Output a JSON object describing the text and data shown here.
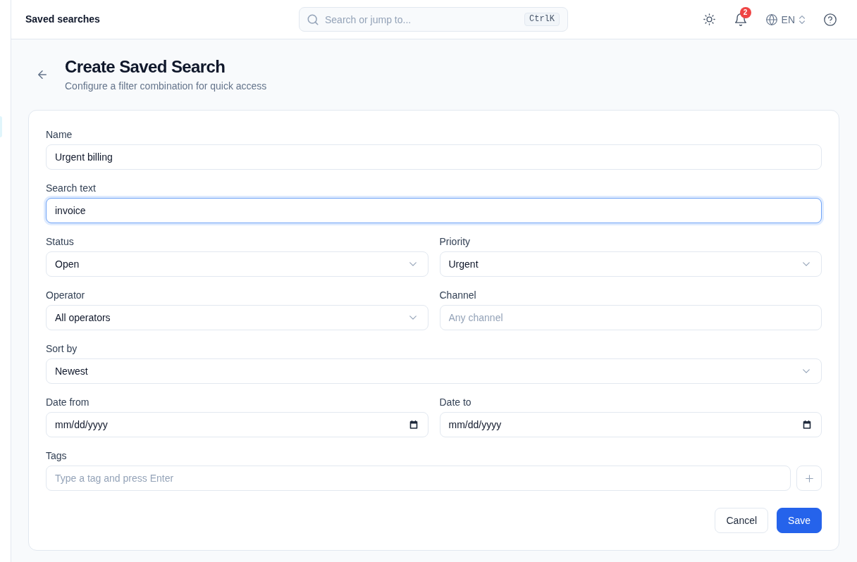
{
  "topbar": {
    "title": "Saved searches",
    "search": {
      "placeholder": "Search or jump to...",
      "shortcut": "CtrlK"
    },
    "notification_count": "2",
    "language": "EN"
  },
  "header": {
    "title": "Create Saved Search",
    "subtitle": "Configure a filter combination for quick access"
  },
  "form": {
    "rows": [
      [
        {
          "kind": "text",
          "label": "Name",
          "value": "Urgent billing",
          "focused": false
        }
      ],
      [
        {
          "kind": "text",
          "label": "Search text",
          "value": "invoice",
          "focused": true
        }
      ],
      [
        {
          "kind": "select",
          "label": "Status",
          "value": "Open",
          "focused": false
        },
        {
          "kind": "select",
          "label": "Priority",
          "value": "Urgent",
          "focused": false
        }
      ],
      [
        {
          "kind": "select",
          "label": "Operator",
          "value": "All operators",
          "focused": false
        },
        {
          "kind": "text",
          "label": "Channel",
          "placeholder": "Any channel",
          "focused": false
        }
      ],
      [
        {
          "kind": "select",
          "label": "Sort by",
          "value": "Newest",
          "focused": false
        }
      ],
      [
        {
          "kind": "date",
          "label": "Date from",
          "placeholder": "mm/dd/yyyy",
          "focused": false
        },
        {
          "kind": "date",
          "label": "Date to",
          "placeholder": "mm/dd/yyyy",
          "focused": false
        }
      ],
      [
        {
          "kind": "tags",
          "label": "Tags",
          "placeholder": "Type a tag and press Enter",
          "focused": false
        }
      ]
    ],
    "buttons": [
      {
        "kind": "secondary",
        "label": "Cancel"
      },
      {
        "kind": "primary",
        "label": "Save"
      }
    ]
  }
}
